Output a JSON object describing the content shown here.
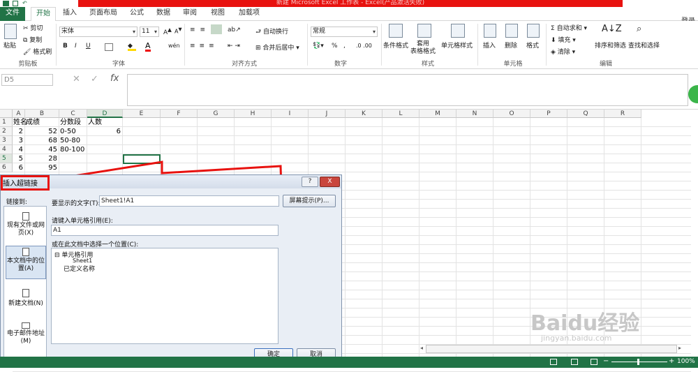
{
  "title": "新建 Microsoft Excel 工作表 - Excel(产品激活失败)",
  "login": "登录",
  "tabs": [
    "文件",
    "开始",
    "插入",
    "页面布局",
    "公式",
    "数据",
    "审阅",
    "视图",
    "加载项"
  ],
  "ribbon": {
    "clipboard": {
      "paste": "粘贴",
      "cut": "剪切",
      "copy": "复制",
      "format_painter": "格式刷",
      "label": "剪贴板"
    },
    "font": {
      "name": "宋体",
      "size": "11",
      "label": "字体",
      "bold": "B",
      "italic": "I",
      "underline": "U"
    },
    "alignment": {
      "wrap": "自动换行",
      "merge": "合并后居中",
      "label": "对齐方式"
    },
    "number": {
      "format": "常规",
      "percent": "%",
      "comma": ",",
      "label": "数字"
    },
    "styles": {
      "conditional": "条件格式",
      "table": "套用\n表格格式",
      "cell_styles": "单元格样式",
      "label": "样式"
    },
    "cells": {
      "insert": "插入",
      "delete": "删除",
      "format": "格式",
      "label": "单元格"
    },
    "editing": {
      "autosum": "自动求和",
      "fill": "填充",
      "clear": "清除",
      "sort": "排序和筛选",
      "find": "查找和选择",
      "label": "编辑"
    }
  },
  "formula_bar": {
    "namebox": "D5",
    "cancel": "✕",
    "enter": "✓",
    "fx": "fx"
  },
  "columns": [
    "A",
    "B",
    "C",
    "D",
    "E",
    "F",
    "G",
    "H",
    "I",
    "J",
    "K",
    "L",
    "M",
    "N",
    "O",
    "P",
    "Q",
    "R"
  ],
  "rows": [
    "1",
    "2",
    "3",
    "4",
    "5",
    "6"
  ],
  "cells": {
    "A1": "姓名",
    "B1": "成绩",
    "C1": "分数段",
    "D1": "人数",
    "A2": "2",
    "B2": "52",
    "C2": "0-50",
    "D2": "6",
    "A3": "3",
    "B3": "68",
    "C3": "50-80",
    "A4": "4",
    "B4": "45",
    "C4": "80-100",
    "A5": "5",
    "B5": "28",
    "A6": "6",
    "B6": "95"
  },
  "dialog": {
    "title": "插入超链接",
    "help": "?",
    "close": "X",
    "link_to": "链接到:",
    "links": [
      "现有文件或网页(X)",
      "本文档中的位置(A)",
      "新建文档(N)",
      "电子邮件地址(M)"
    ],
    "display_text_label": "要显示的文字(T):",
    "display_text_value": "Sheet1!A1",
    "screentip": "屏幕提示(P)...",
    "cell_ref_label": "请键入单元格引用(E):",
    "cell_ref_value": "A1",
    "place_label": "或在此文档中选择一个位置(C):",
    "tree": [
      "单元格引用",
      "Sheet1",
      "已定义名称"
    ],
    "ok": "确定",
    "cancel": "取消"
  },
  "status": {
    "zoom": "100%"
  },
  "watermark": {
    "brand": "Baidu经验",
    "url": "jingyan.baidu.com"
  },
  "colors": {
    "excel_green": "#217346",
    "title_red": "#e8120f",
    "annotation_red": "#e8120f"
  }
}
